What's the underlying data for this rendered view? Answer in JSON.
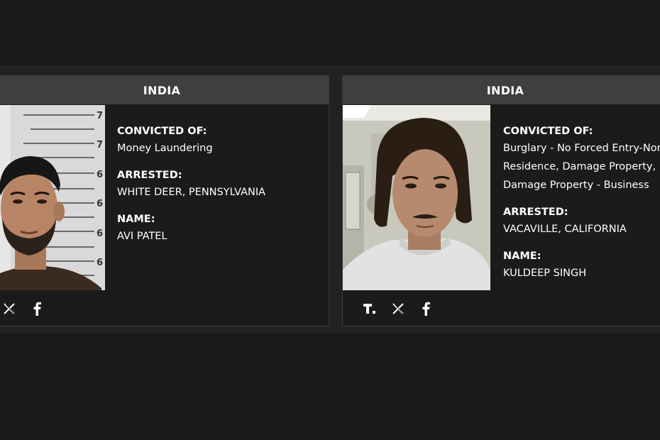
{
  "cards": [
    {
      "country": "INDIA",
      "convicted_label": "CONVICTED OF:",
      "convicted_lines": [
        "Money Laundering"
      ],
      "arrested_label": "ARRESTED:",
      "arrested": "WHITE DEER, PENNSYLVANIA",
      "name_label": "NAME:",
      "name": "AVI PATEL",
      "social_icons": [
        "x-icon",
        "facebook-icon"
      ]
    },
    {
      "country": "INDIA",
      "convicted_label": "CONVICTED OF:",
      "convicted_lines": [
        "Burglary - No Forced Entry-Non",
        "Residence, Damage Property,",
        "Damage Property - Business"
      ],
      "arrested_label": "ARRESTED:",
      "arrested": "VACAVILLE, CALIFORNIA",
      "name_label": "NAME:",
      "name": "KULDEEP SINGH",
      "social_icons": [
        "truthsocial-icon",
        "x-icon",
        "facebook-icon"
      ]
    }
  ],
  "mugshot_ruler_digits": [
    "7",
    "7",
    "6",
    "6",
    "6",
    "6"
  ],
  "colors": {
    "page_background": "#1a1a1a",
    "card_background": "#1b1b1b",
    "card_header": "#3f3f3f",
    "text": "#ffffff"
  }
}
